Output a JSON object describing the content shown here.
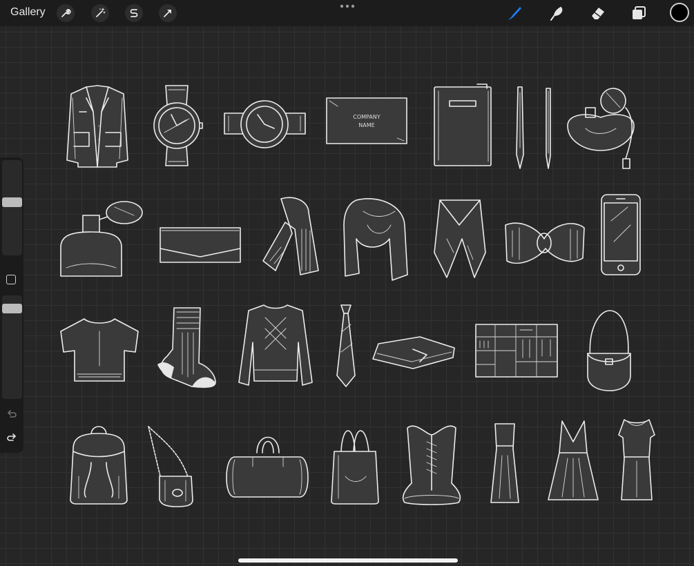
{
  "toolbar": {
    "gallery_label": "Gallery",
    "left_tools": [
      "wrench-icon",
      "magic-wand-icon",
      "selection-s-icon",
      "arrow-transform-icon"
    ],
    "right_tools": [
      "brush-icon",
      "smudge-icon",
      "eraser-icon",
      "layers-icon"
    ],
    "active_tool": "brush-icon",
    "accent_color": "#1e7cf2",
    "current_color": "#000000"
  },
  "sidebar": {
    "brush_size_level": 0.55,
    "opacity_level": 0.15,
    "modify_button": "square-icon",
    "undo": "undo-icon",
    "redo": "redo-icon"
  },
  "canvas": {
    "background": "#262626",
    "grid_color": "#323232",
    "card_text": "COMPANY NAME",
    "items": [
      "blazer",
      "wristwatch-1",
      "wristwatch-2",
      "business-card",
      "notebook",
      "pen",
      "pencil",
      "perfume-1",
      "perfume-2",
      "envelope-clutch",
      "scarf-1",
      "scarf-2",
      "scarf-3",
      "scarf-4",
      "smartphone",
      "t-shirt",
      "sock",
      "sweater",
      "necktie",
      "wallet",
      "wardrobe",
      "saddle-bag",
      "backpack",
      "chain-purse",
      "duffel-bag",
      "tote-bag",
      "corset",
      "long-dress",
      "a-line-dress",
      "sheath-dress"
    ]
  }
}
